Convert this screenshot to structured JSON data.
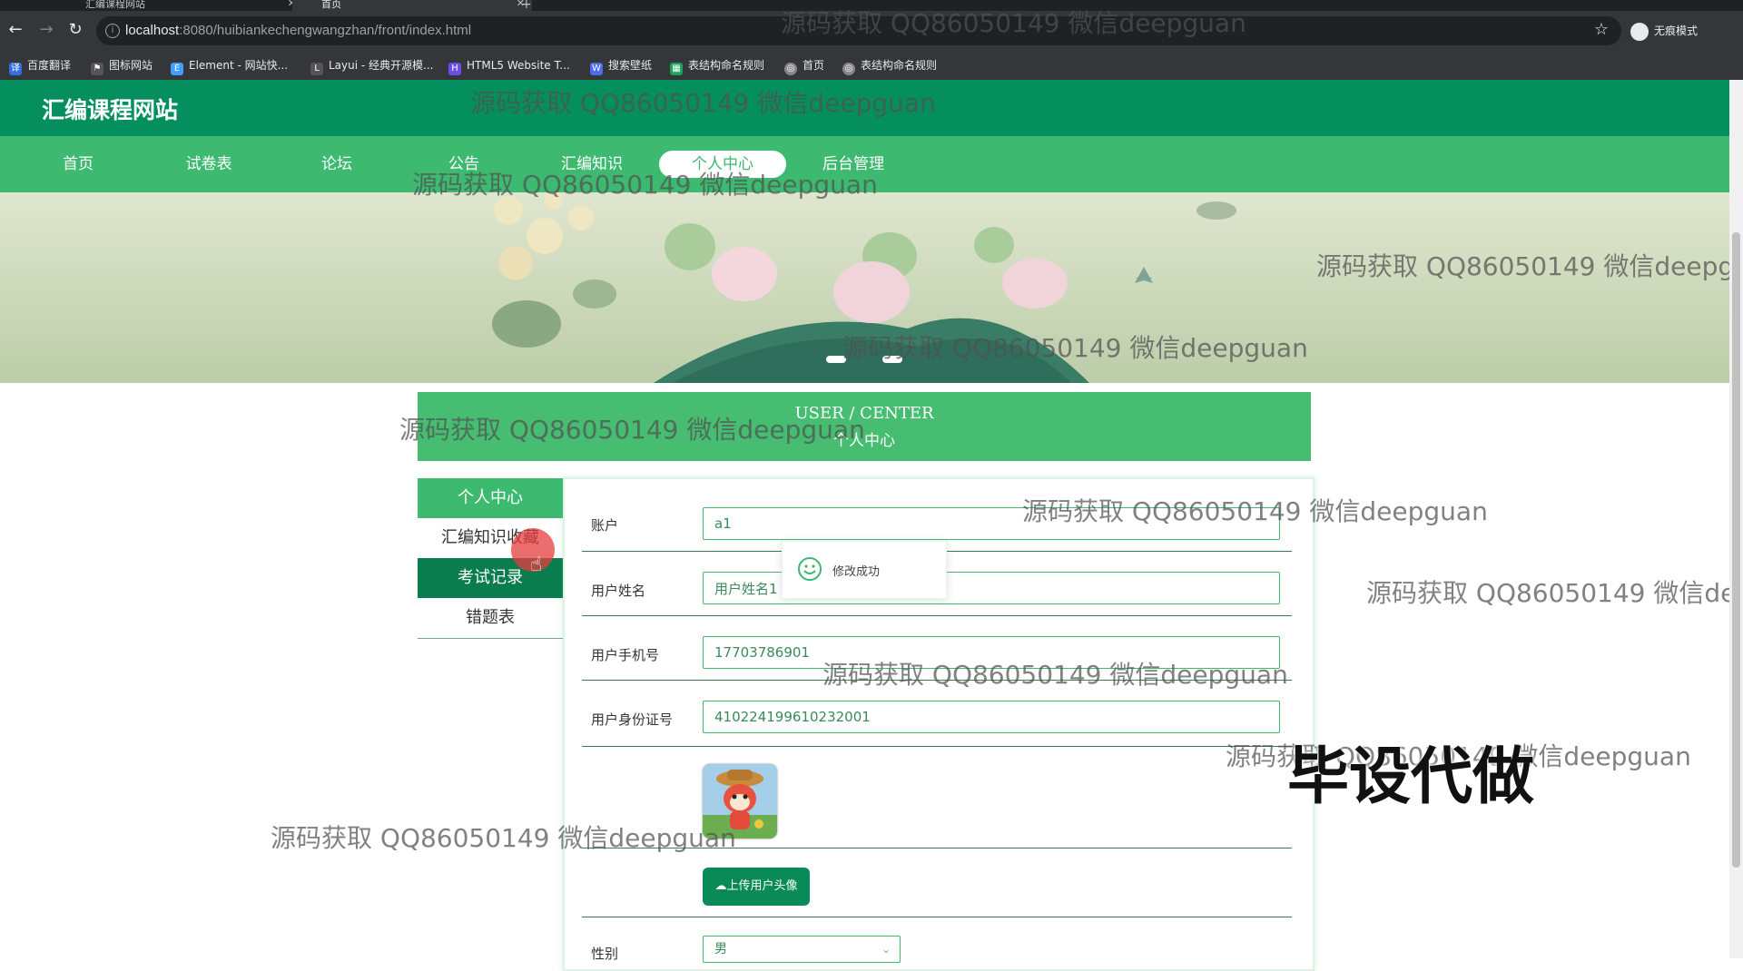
{
  "browser": {
    "tabs": [
      {
        "title": "汇编课程网站",
        "active": false
      },
      {
        "title": "首页",
        "active": true
      }
    ],
    "url_host": "localhost",
    "url_rest": ":8080/huibiankechengwangzhan/front/index.html",
    "profile_label": "无痕模式",
    "bookmarks": [
      "百度翻译",
      "图标网站",
      "Element - 网站快...",
      "Layui - 经典开源模...",
      "HTML5 Website T...",
      "搜索壁纸",
      "表结构命名规则",
      "首页",
      "表结构命名规则"
    ]
  },
  "site": {
    "title": "汇编课程网站",
    "nav": [
      "首页",
      "试卷表",
      "论坛",
      "公告",
      "汇编知识",
      "个人中心",
      "后台管理"
    ],
    "active_nav": "个人中心"
  },
  "user_center": {
    "title_en": "USER / CENTER",
    "title_cn": "个人中心",
    "sidebar": [
      "个人中心",
      "汇编知识收藏",
      "考试记录",
      "错题表"
    ],
    "form": {
      "account_label": "账户",
      "account_value": "a1",
      "name_label": "用户姓名",
      "name_value": "用户姓名1",
      "phone_label": "用户手机号",
      "phone_value": "17703786901",
      "idcard_label": "用户身份证号",
      "idcard_value": "410224199610232001",
      "upload_label": "上传用户头像",
      "gender_label": "性别",
      "gender_value": "男"
    }
  },
  "toast": {
    "message": "修改成功"
  },
  "overlay": {
    "watermark": "源码获取 QQ86050149 微信deepguan",
    "promo": "毕设代做"
  },
  "colors": {
    "primary": "#3dba70",
    "header": "#058f5f",
    "dark_green": "#0a7d4f"
  }
}
